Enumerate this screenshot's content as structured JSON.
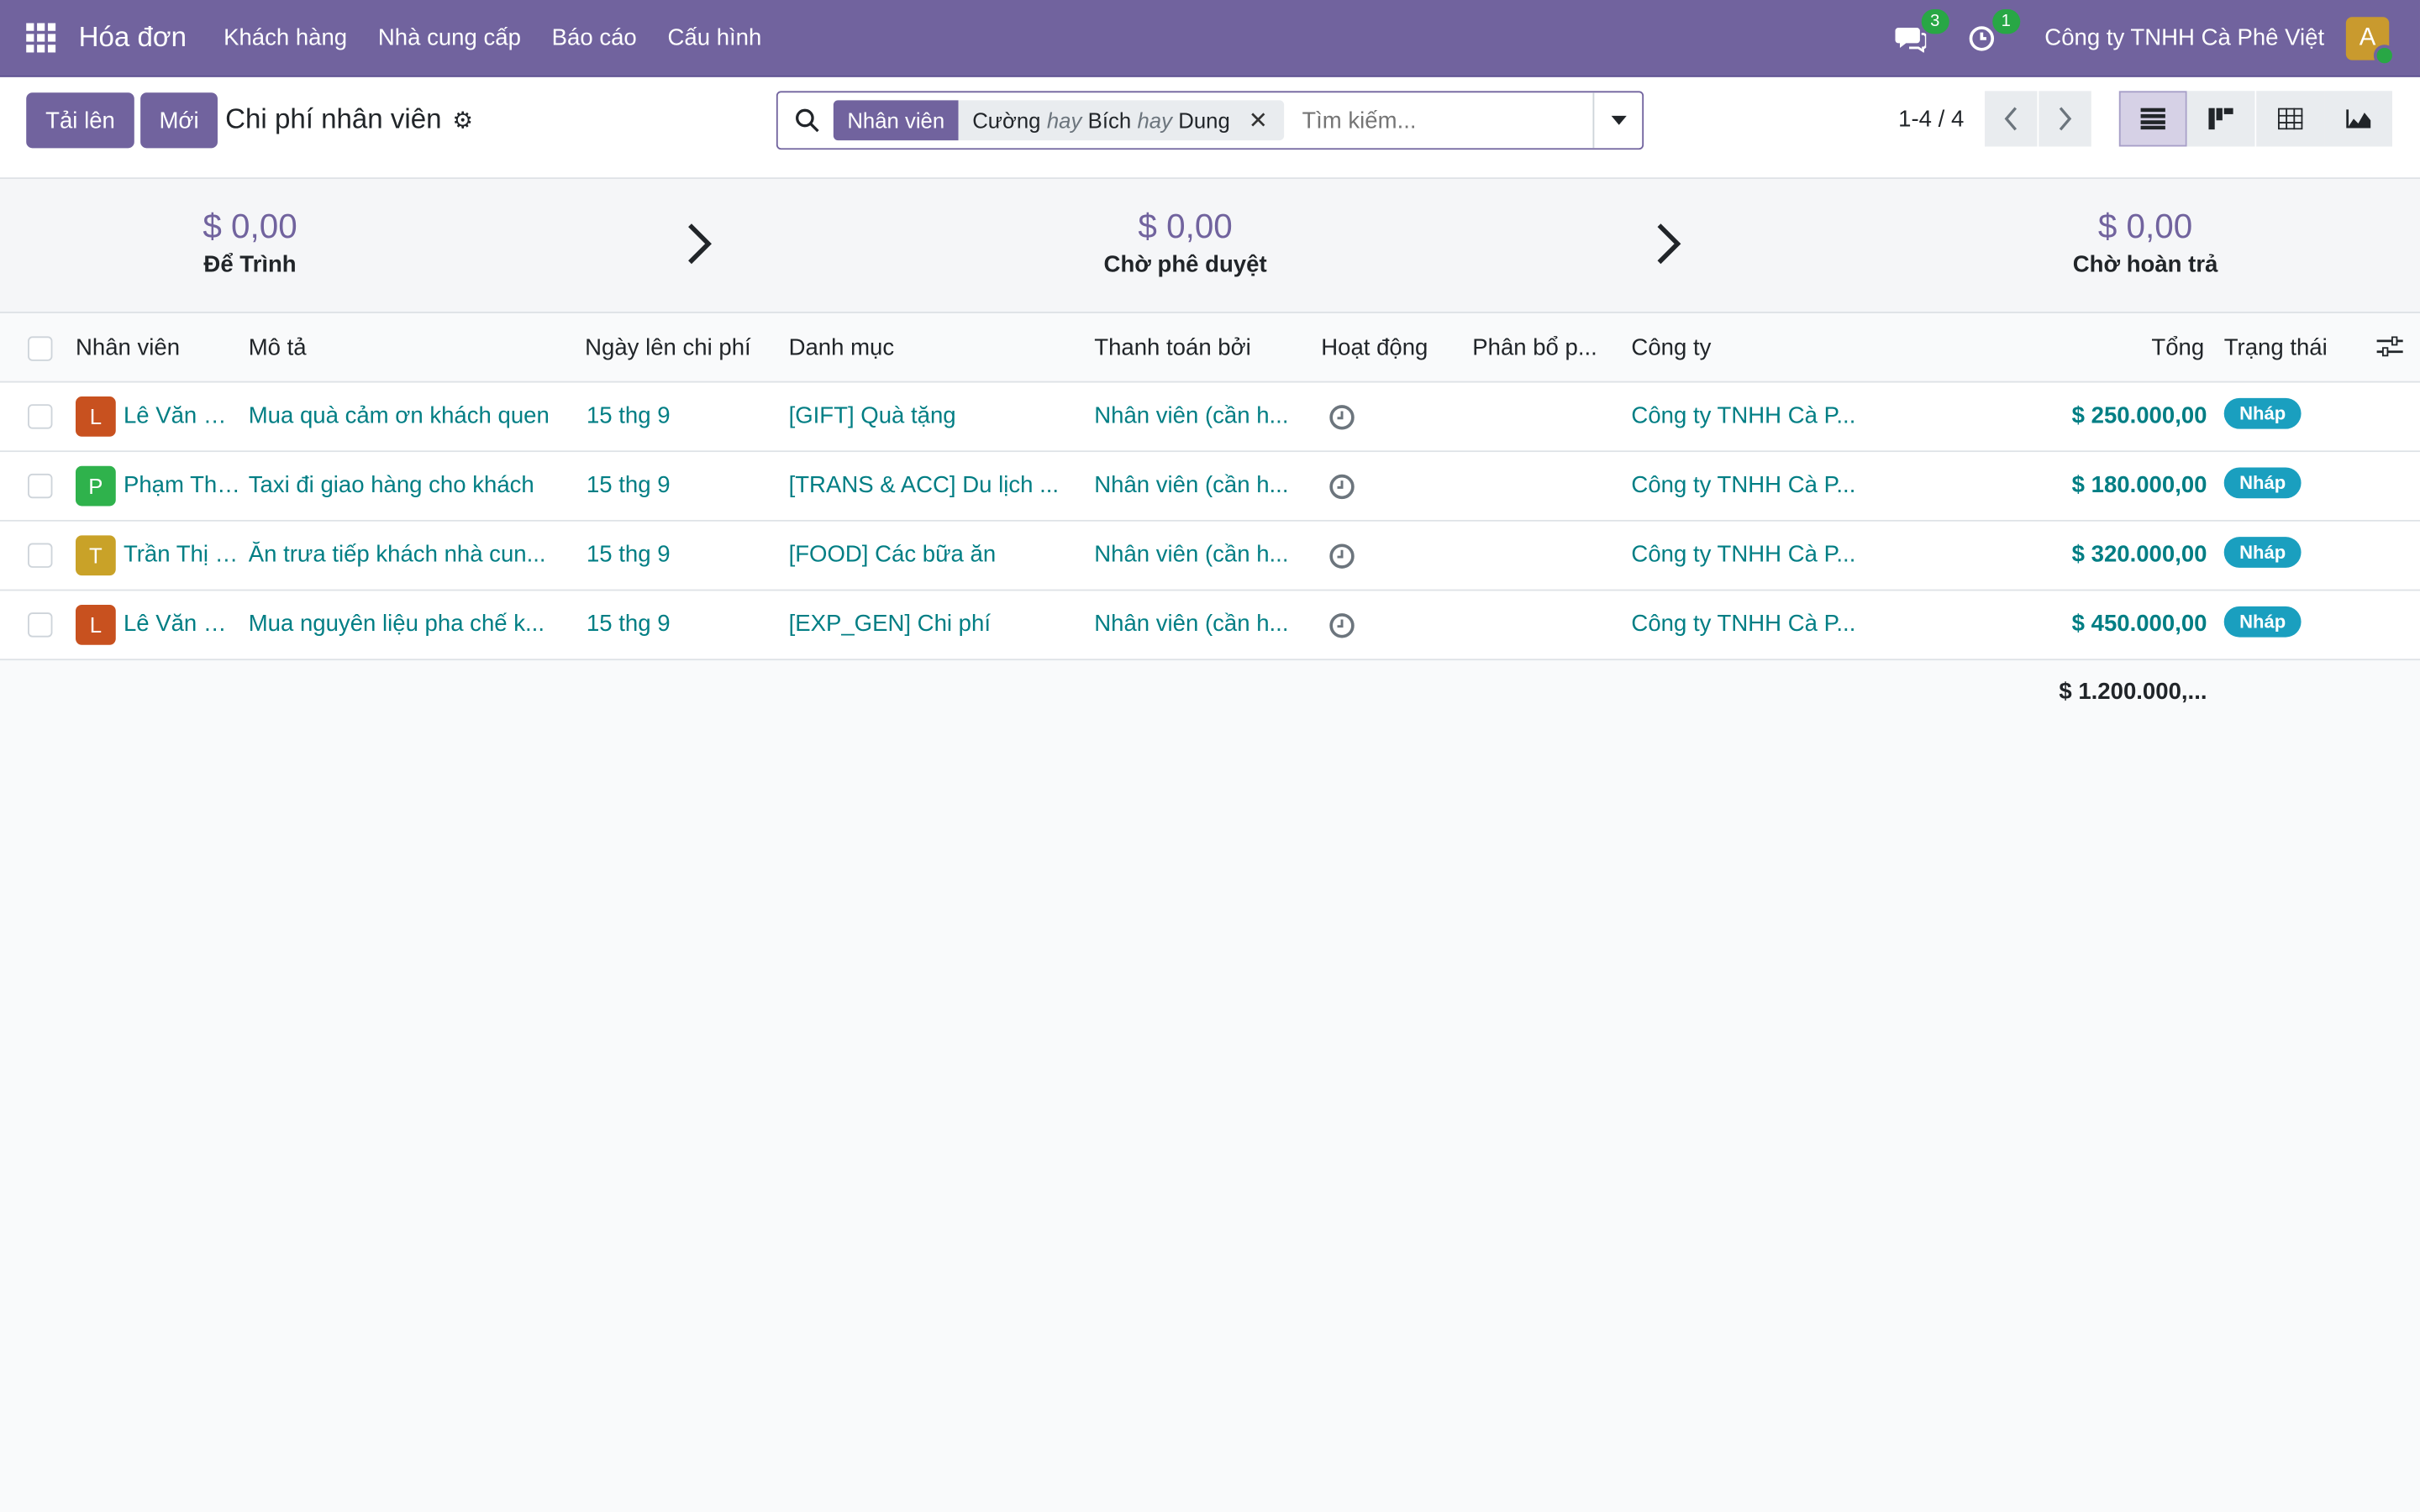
{
  "navbar": {
    "app_name": "Hóa đơn",
    "menu": [
      "Khách hàng",
      "Nhà cung cấp",
      "Báo cáo",
      "Cấu hình"
    ],
    "messages_count": "3",
    "activities_count": "1",
    "company": "Công ty TNHH Cà Phê Việt",
    "user_initial": "A"
  },
  "control": {
    "upload_label": "Tải lên",
    "new_label": "Mới",
    "title": "Chi phí nhân viên",
    "facet_label": "Nhân viên",
    "facet_values": [
      "Cường",
      "Bích",
      "Dung"
    ],
    "facet_or": "hay",
    "search_placeholder": "Tìm kiếm...",
    "pager": "1-4 / 4"
  },
  "summary": [
    {
      "amount": "$ 0,00",
      "label": "Để Trình"
    },
    {
      "amount": "$ 0,00",
      "label": "Chờ phê duyệt"
    },
    {
      "amount": "$ 0,00",
      "label": "Chờ hoàn trả"
    }
  ],
  "table": {
    "columns": [
      "Nhân viên",
      "Mô tả",
      "Ngày lên chi phí",
      "Danh mục",
      "Thanh toán bởi",
      "Hoạt động",
      "Phân bổ p...",
      "Công ty",
      "Tổng",
      "Trạng thái"
    ],
    "rows": [
      {
        "initial": "L",
        "color": "#c8511f",
        "employee": "Lê Văn Cường",
        "description": "Mua quà cảm ơn khách quen",
        "date": "15 thg 9",
        "category": "[GIFT] Quà tặng",
        "paid_by": "Nhân viên (cần h...",
        "company": "Công ty TNHH Cà P...",
        "total": "$ 250.000,00",
        "status": "Nháp"
      },
      {
        "initial": "P",
        "color": "#2fb24c",
        "employee": "Phạm Thị Dung",
        "description": "Taxi đi giao hàng cho khách",
        "date": "15 thg 9",
        "category": "[TRANS & ACC] Du lịch ...",
        "paid_by": "Nhân viên (cần h...",
        "company": "Công ty TNHH Cà P...",
        "total": "$ 180.000,00",
        "status": "Nháp"
      },
      {
        "initial": "T",
        "color": "#c9a228",
        "employee": "Trần Thị Bích",
        "description": "Ăn trưa tiếp khách nhà cun...",
        "date": "15 thg 9",
        "category": "[FOOD] Các bữa ăn",
        "paid_by": "Nhân viên (cần h...",
        "company": "Công ty TNHH Cà P...",
        "total": "$ 320.000,00",
        "status": "Nháp"
      },
      {
        "initial": "L",
        "color": "#c8511f",
        "employee": "Lê Văn Cường",
        "description": "Mua nguyên liệu pha chế k...",
        "date": "15 thg 9",
        "category": "[EXP_GEN] Chi phí",
        "paid_by": "Nhân viên (cần h...",
        "company": "Công ty TNHH Cà P...",
        "total": "$ 450.000,00",
        "status": "Nháp"
      }
    ],
    "grand_total": "$ 1.200.000,..."
  }
}
